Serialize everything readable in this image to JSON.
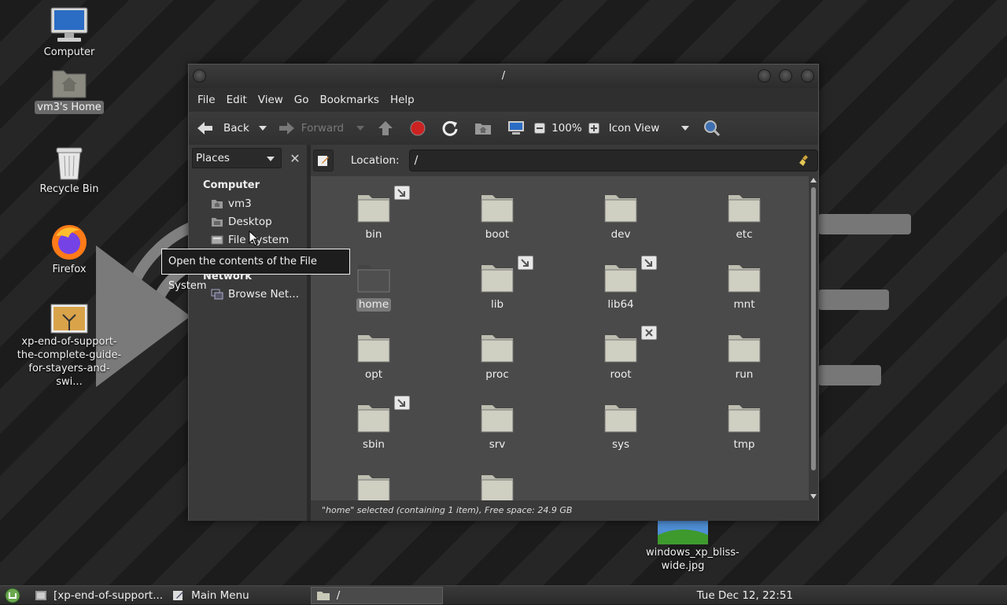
{
  "desktop": {
    "icons": [
      {
        "label": "Computer",
        "icon": "computer-icon"
      },
      {
        "label": "vm3's Home",
        "icon": "home-folder-icon"
      },
      {
        "label": "Recycle Bin",
        "icon": "trash-icon"
      },
      {
        "label": "Firefox",
        "icon": "firefox-icon"
      },
      {
        "label": "xp-end-of-support-the-complete-guide-for-stayers-and-swi...",
        "icon": "image-file-icon"
      },
      {
        "label": "windows_xp_bliss-wide.jpg",
        "icon": "image-file-icon"
      }
    ]
  },
  "window": {
    "title": "/",
    "menu": [
      "File",
      "Edit",
      "View",
      "Go",
      "Bookmarks",
      "Help"
    ],
    "toolbar": {
      "back_label": "Back",
      "forward_label": "Forward",
      "zoom": "100%",
      "view_mode": "Icon View"
    },
    "sidebar": {
      "selector": "Places",
      "sections": [
        {
          "header": "Computer",
          "items": [
            "vm3",
            "Desktop",
            "File System"
          ]
        },
        {
          "header": "Network",
          "items": [
            "Browse Net..."
          ]
        }
      ]
    },
    "location": {
      "label": "Location:",
      "value": "/"
    },
    "files": [
      {
        "name": "bin",
        "emblem": "symlink"
      },
      {
        "name": "boot"
      },
      {
        "name": "dev"
      },
      {
        "name": "etc"
      },
      {
        "name": "home",
        "selected": true
      },
      {
        "name": "lib",
        "emblem": "symlink"
      },
      {
        "name": "lib64",
        "emblem": "symlink"
      },
      {
        "name": "mnt"
      },
      {
        "name": "opt"
      },
      {
        "name": "proc"
      },
      {
        "name": "root",
        "emblem": "no-access"
      },
      {
        "name": "run"
      },
      {
        "name": "sbin",
        "emblem": "symlink"
      },
      {
        "name": "srv"
      },
      {
        "name": "sys"
      },
      {
        "name": "tmp"
      },
      {
        "name": ""
      },
      {
        "name": ""
      }
    ],
    "status": "\"home\" selected (containing 1 item), Free space: 24.9 GB"
  },
  "tooltip": "Open the contents of the File System",
  "taskbar": {
    "tasks": [
      "[xp-end-of-support...",
      "Main Menu",
      "/"
    ],
    "clock": "Tue Dec 12, 22:51"
  }
}
